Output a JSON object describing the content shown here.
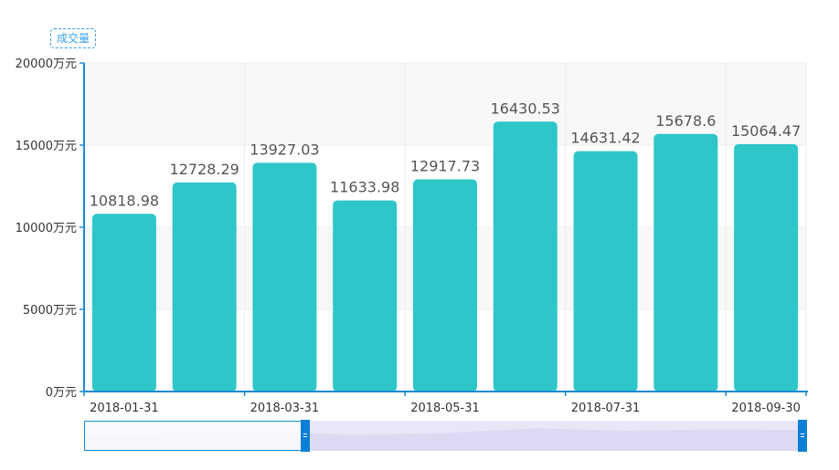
{
  "legend": {
    "label": "成交量"
  },
  "colors": {
    "bar": "#2ec6c9",
    "axis": "#1a8bd1",
    "grid": "#eeeeee",
    "band": "#f8f8f8",
    "label": "#555555",
    "tick_text": "#333333",
    "zoom_border": "#1a8bd1",
    "zoom_fill": "#ebe6f7",
    "zoom_handle": "#0a7fd6"
  },
  "chart_data": {
    "type": "bar",
    "series": [
      {
        "name": "成交量",
        "values": [
          10818.98,
          12728.29,
          13927.03,
          11633.98,
          12917.73,
          16430.53,
          14631.42,
          15678.6,
          15064.47
        ]
      }
    ],
    "data_labels": [
      "10818.98",
      "12728.29",
      "13927.03",
      "11633.98",
      "12917.73",
      "16430.53",
      "14631.42",
      "15678.6",
      "15064.47"
    ],
    "x_tick_labels": [
      "2018-01-31",
      "2018-03-31",
      "2018-05-31",
      "2018-07-31",
      "2018-09-30"
    ],
    "y_ticks": [
      0,
      5000,
      10000,
      15000,
      20000
    ],
    "y_tick_labels": [
      "0万元",
      "5000万元",
      "10000万元",
      "15000万元",
      "20000万元"
    ],
    "ylim": [
      0,
      20000
    ],
    "legend_position": "top-left",
    "grid": true,
    "data_zoom": {
      "start": 0,
      "end": 100
    }
  }
}
